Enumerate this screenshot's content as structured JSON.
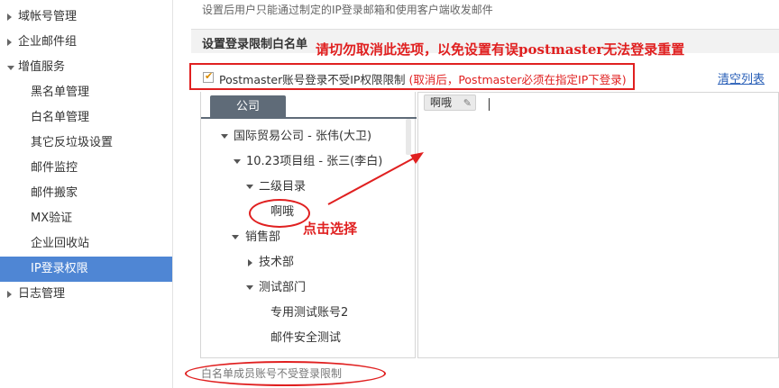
{
  "sidebar": {
    "items": [
      {
        "label": "域帐号管理",
        "level": "top",
        "expanded": false
      },
      {
        "label": "企业邮件组",
        "level": "top",
        "expanded": false
      },
      {
        "label": "增值服务",
        "level": "top",
        "expanded": true
      },
      {
        "label": "黑名单管理",
        "level": "sub"
      },
      {
        "label": "白名单管理",
        "level": "sub"
      },
      {
        "label": "其它反垃圾设置",
        "level": "sub"
      },
      {
        "label": "邮件监控",
        "level": "sub"
      },
      {
        "label": "邮件搬家",
        "level": "sub"
      },
      {
        "label": "MX验证",
        "level": "sub"
      },
      {
        "label": "企业回收站",
        "level": "sub"
      },
      {
        "label": "IP登录权限",
        "level": "sub",
        "active": true
      },
      {
        "label": "日志管理",
        "level": "top",
        "expanded": false
      }
    ]
  },
  "main": {
    "top_hint": "设置后用户只能通过制定的IP登录邮箱和使用客户端收发邮件",
    "section_title": "设置登录限制白名单",
    "warning_annotation": "请切勿取消此选项，以免设置有误postmaster无法登录重置",
    "checkbox": {
      "checked": true,
      "label": "Postmaster账号登录不受IP权限限制 ",
      "note": "(取消后，Postmaster必须在指定IP下登录)"
    },
    "clear_list": "清空列表",
    "tabs": [
      {
        "label": "公司"
      }
    ],
    "tree": [
      {
        "label": "国际贸易公司 - 张伟(大卫)",
        "toggle": "down"
      },
      {
        "label": "10.23项目组 - 张三(李白)",
        "toggle": "down"
      },
      {
        "label": "二级目录",
        "toggle": "down"
      },
      {
        "label": "啊哦",
        "toggle": "none"
      },
      {
        "label": "销售部",
        "toggle": "down"
      },
      {
        "label": "技术部",
        "toggle": "right"
      },
      {
        "label": "测试部门",
        "toggle": "down"
      },
      {
        "label": "专用测试账号2",
        "toggle": "none"
      },
      {
        "label": "邮件安全测试",
        "toggle": "none"
      }
    ],
    "whitelist_members": [
      {
        "label": "啊哦"
      }
    ],
    "footer_note": "白名单成员账号不受登录限制",
    "click_annotation": "点击选择"
  },
  "colors": {
    "accent": "#4f86d4",
    "annotation_red": "#e02020",
    "tab_dark": "#5f6b78",
    "link": "#2a60b8"
  }
}
